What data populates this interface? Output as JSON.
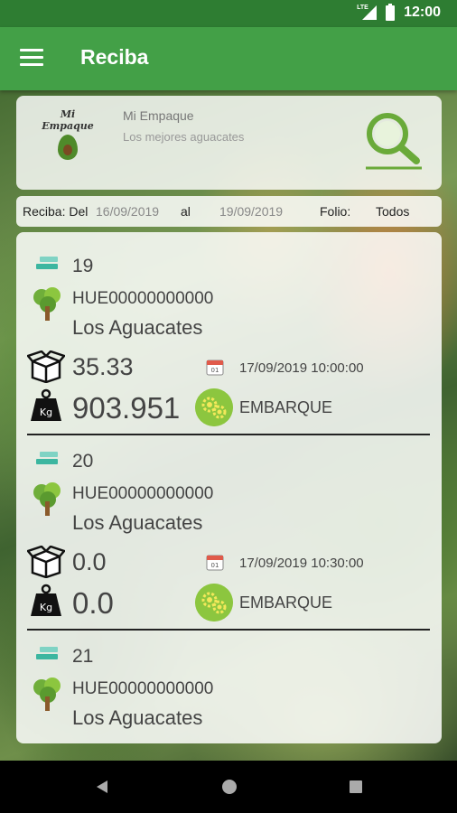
{
  "status_bar": {
    "network": "LTE",
    "time": "12:00"
  },
  "app_bar": {
    "title": "Reciba",
    "menu_icon": "hamburger-menu-icon"
  },
  "header": {
    "logo_text_1": "Mi",
    "logo_text_2": "Empaque",
    "company_name": "Mi Empaque",
    "slogan": "Los mejores aguacates",
    "search_icon": "magnifier-icon"
  },
  "filter": {
    "label": "Reciba: Del",
    "date_from": "16/09/2019",
    "al": "al",
    "date_to": "19/09/2019",
    "folio_label": "Folio:",
    "folio_value": "Todos"
  },
  "records": [
    {
      "folio": "19",
      "code": "HUE00000000000",
      "place": "Los Aguacates",
      "boxes": "35.33",
      "datetime": "17/09/2019 10:00:00",
      "weight": "903.951",
      "kg_label": "Kg",
      "status": "EMBARQUE"
    },
    {
      "folio": "20",
      "code": "HUE00000000000",
      "place": "Los Aguacates",
      "boxes": "0.0",
      "datetime": "17/09/2019 10:30:00",
      "weight": "0.0",
      "kg_label": "Kg",
      "status": "EMBARQUE"
    },
    {
      "folio": "21",
      "code": "HUE00000000000",
      "place": "Los Aguacates"
    }
  ],
  "colors": {
    "status_bar": "#2e7d32",
    "app_bar": "#43a047",
    "accent_green": "#8cc63f",
    "teal": "#3cb6a0"
  }
}
